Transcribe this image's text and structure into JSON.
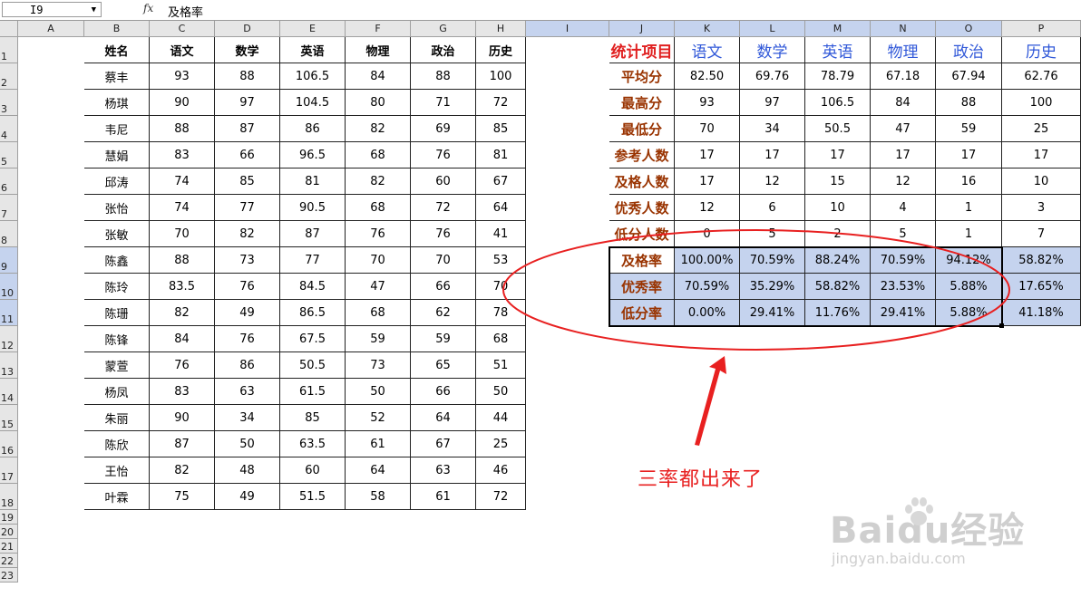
{
  "formula_bar": {
    "name_box": "I9",
    "fx_label": "fx",
    "formula": "及格率"
  },
  "columns": [
    "A",
    "B",
    "C",
    "D",
    "E",
    "F",
    "G",
    "H",
    "I",
    "J",
    "K",
    "L",
    "M",
    "N",
    "O",
    "P"
  ],
  "rows": [
    "1",
    "2",
    "3",
    "4",
    "5",
    "6",
    "7",
    "8",
    "9",
    "10",
    "11",
    "12",
    "13",
    "14",
    "15",
    "16",
    "17",
    "18",
    "19",
    "20",
    "21",
    "22",
    "23"
  ],
  "left_table": {
    "headers": [
      "姓名",
      "语文",
      "数学",
      "英语",
      "物理",
      "政治",
      "历史"
    ],
    "rows": [
      [
        "蔡丰",
        "93",
        "88",
        "106.5",
        "84",
        "88",
        "100"
      ],
      [
        "杨琪",
        "90",
        "97",
        "104.5",
        "80",
        "71",
        "72"
      ],
      [
        "韦尼",
        "88",
        "87",
        "86",
        "82",
        "69",
        "85"
      ],
      [
        "慧娟",
        "83",
        "66",
        "96.5",
        "68",
        "76",
        "81"
      ],
      [
        "邱涛",
        "74",
        "85",
        "81",
        "82",
        "60",
        "67"
      ],
      [
        "张怡",
        "74",
        "77",
        "90.5",
        "68",
        "72",
        "64"
      ],
      [
        "张敏",
        "70",
        "82",
        "87",
        "76",
        "76",
        "41"
      ],
      [
        "陈鑫",
        "88",
        "73",
        "77",
        "70",
        "70",
        "53"
      ],
      [
        "陈玲",
        "83.5",
        "76",
        "84.5",
        "47",
        "66",
        "70"
      ],
      [
        "陈珊",
        "82",
        "49",
        "86.5",
        "68",
        "62",
        "78"
      ],
      [
        "陈锋",
        "84",
        "76",
        "67.5",
        "59",
        "59",
        "68"
      ],
      [
        "蒙萱",
        "76",
        "86",
        "50.5",
        "73",
        "65",
        "51"
      ],
      [
        "杨凤",
        "83",
        "63",
        "61.5",
        "50",
        "66",
        "50"
      ],
      [
        "朱丽",
        "90",
        "34",
        "85",
        "52",
        "64",
        "44"
      ],
      [
        "陈欣",
        "87",
        "50",
        "63.5",
        "61",
        "67",
        "25"
      ],
      [
        "王怡",
        "82",
        "48",
        "60",
        "64",
        "63",
        "46"
      ],
      [
        "叶霖",
        "75",
        "49",
        "51.5",
        "58",
        "61",
        "72"
      ]
    ]
  },
  "stats_table": {
    "corner": "统计项目",
    "headers": [
      "语文",
      "数学",
      "英语",
      "物理",
      "政治",
      "历史"
    ],
    "rows": [
      {
        "label": "平均分",
        "values": [
          "82.50",
          "69.76",
          "78.79",
          "67.18",
          "67.94",
          "62.76"
        ]
      },
      {
        "label": "最高分",
        "values": [
          "93",
          "97",
          "106.5",
          "84",
          "88",
          "100"
        ]
      },
      {
        "label": "最低分",
        "values": [
          "70",
          "34",
          "50.5",
          "47",
          "59",
          "25"
        ]
      },
      {
        "label": "参考人数",
        "values": [
          "17",
          "17",
          "17",
          "17",
          "17",
          "17"
        ]
      },
      {
        "label": "及格人数",
        "values": [
          "17",
          "12",
          "15",
          "12",
          "16",
          "10"
        ]
      },
      {
        "label": "优秀人数",
        "values": [
          "12",
          "6",
          "10",
          "4",
          "1",
          "3"
        ]
      },
      {
        "label": "低分人数",
        "values": [
          "0",
          "5",
          "2",
          "5",
          "1",
          "7"
        ]
      },
      {
        "label": "及格率",
        "values": [
          "100.00%",
          "70.59%",
          "88.24%",
          "70.59%",
          "94.12%",
          "58.82%"
        ]
      },
      {
        "label": "优秀率",
        "values": [
          "70.59%",
          "35.29%",
          "58.82%",
          "23.53%",
          "5.88%",
          "17.65%"
        ]
      },
      {
        "label": "低分率",
        "values": [
          "0.00%",
          "29.41%",
          "11.76%",
          "29.41%",
          "5.88%",
          "41.18%"
        ]
      }
    ]
  },
  "annotation": {
    "text": "三率都出来了",
    "color": "#e82020"
  },
  "watermark": {
    "logo": "Baidu经验",
    "url": "jingyan.baidu.com"
  },
  "colors": {
    "selection": "#c5d3ee",
    "stats_corner": "#e02020",
    "stats_header": "#2f57d8",
    "stats_label": "#993300"
  }
}
